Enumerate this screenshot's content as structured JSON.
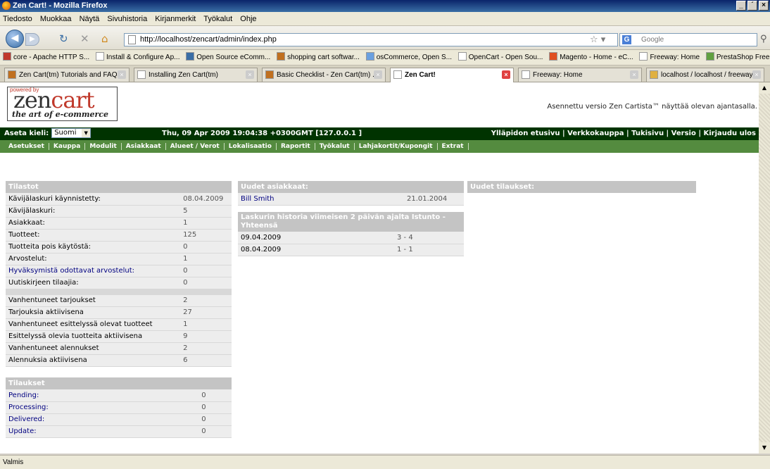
{
  "window": {
    "title": "Zen Cart! - Mozilla Firefox",
    "buttons": [
      "_",
      "´",
      "×"
    ]
  },
  "menubar": [
    "Tiedosto",
    "Muokkaa",
    "Näytä",
    "Sivuhistoria",
    "Kirjanmerkit",
    "Työkalut",
    "Ohje"
  ],
  "navbar": {
    "url": "http://localhost/zencart/admin/index.php",
    "search_placeholder": "Google"
  },
  "bookmarks": [
    "core - Apache HTTP S...",
    "Install & Configure Ap...",
    "Open Source eComm...",
    "shopping cart softwar...",
    "osCommerce, Open S...",
    "OpenCart - Open Sou...",
    "Magento - Home - eC...",
    "Freeway: Home",
    "PrestaShop Free Ope..."
  ],
  "tabs": [
    "Zen Cart(tm) Tutorials and FAQs",
    "Installing Zen Cart(tm)",
    "Basic Checklist - Zen Cart(tm) ...",
    "Zen Cart!",
    "Freeway: Home",
    "localhost / localhost / freeway ..."
  ],
  "status": "Valmis",
  "logo": {
    "powered": "powered by",
    "text1": "zen",
    "text2": "cart",
    "tagline": "the art of e-commerce"
  },
  "version_text": "Asennettu versio Zen Cartista™ näyttää olevan ajantasalla.",
  "header": {
    "lang_label": "Aseta kieli:",
    "lang_value": "Suomi",
    "datetime": "Thu, 09 Apr 2009 19:04:38 +0300GMT [127.0.0.1 ]",
    "links": "Ylläpidon etusivu | Verkkokauppa | Tukisivu | Versio | Kirjaudu ulos"
  },
  "admin_menu": [
    "Asetukset",
    "Kauppa",
    "Modulit",
    "Asiakkaat",
    "Alueet / Verot",
    "Lokalisaatio",
    "Raportit",
    "Työkalut",
    "Lahjakortit/Kupongit",
    "Extrat"
  ],
  "stats": {
    "title": "Tilastot",
    "rows1": [
      [
        "Kävijälaskuri käynnistetty:",
        "08.04.2009"
      ],
      [
        "Kävijälaskuri:",
        "5"
      ],
      [
        "Asiakkaat:",
        "1"
      ],
      [
        "Tuotteet:",
        "125"
      ],
      [
        "Tuotteita pois käytöstä:",
        "0"
      ],
      [
        "Arvostelut:",
        "1"
      ],
      [
        "Hyväksymistä odottavat arvostelut:",
        "0"
      ],
      [
        "Uutiskirjeen tilaajia:",
        "0"
      ]
    ],
    "rows2": [
      [
        "Vanhentuneet tarjoukset",
        "2"
      ],
      [
        "Tarjouksia aktiivisena",
        "27"
      ],
      [
        "Vanhentuneet esittelyssä olevat tuotteet",
        "1"
      ],
      [
        "Esittelyssä olevia tuotteita aktiivisena",
        "9"
      ],
      [
        "Vanhentuneet alennukset",
        "2"
      ],
      [
        "Alennuksia aktiivisena",
        "6"
      ]
    ]
  },
  "orders": {
    "title": "Tilaukset",
    "rows": [
      [
        "Pending:",
        "0"
      ],
      [
        "Processing:",
        "0"
      ],
      [
        "Delivered:",
        "0"
      ],
      [
        "Update:",
        "0"
      ]
    ]
  },
  "new_customers": {
    "title": "Uudet asiakkaat:",
    "rows": [
      [
        "Bill Smith",
        "21.01.2004"
      ]
    ]
  },
  "counter_history": {
    "title": "Laskurin historia viimeisen 2 päivän ajalta   Istunto - Yhteensä",
    "rows": [
      [
        "09.04.2009",
        "3 - 4"
      ],
      [
        "08.04.2009",
        "1 - 1"
      ]
    ]
  },
  "new_orders": {
    "title": "Uudet tilaukset:"
  }
}
